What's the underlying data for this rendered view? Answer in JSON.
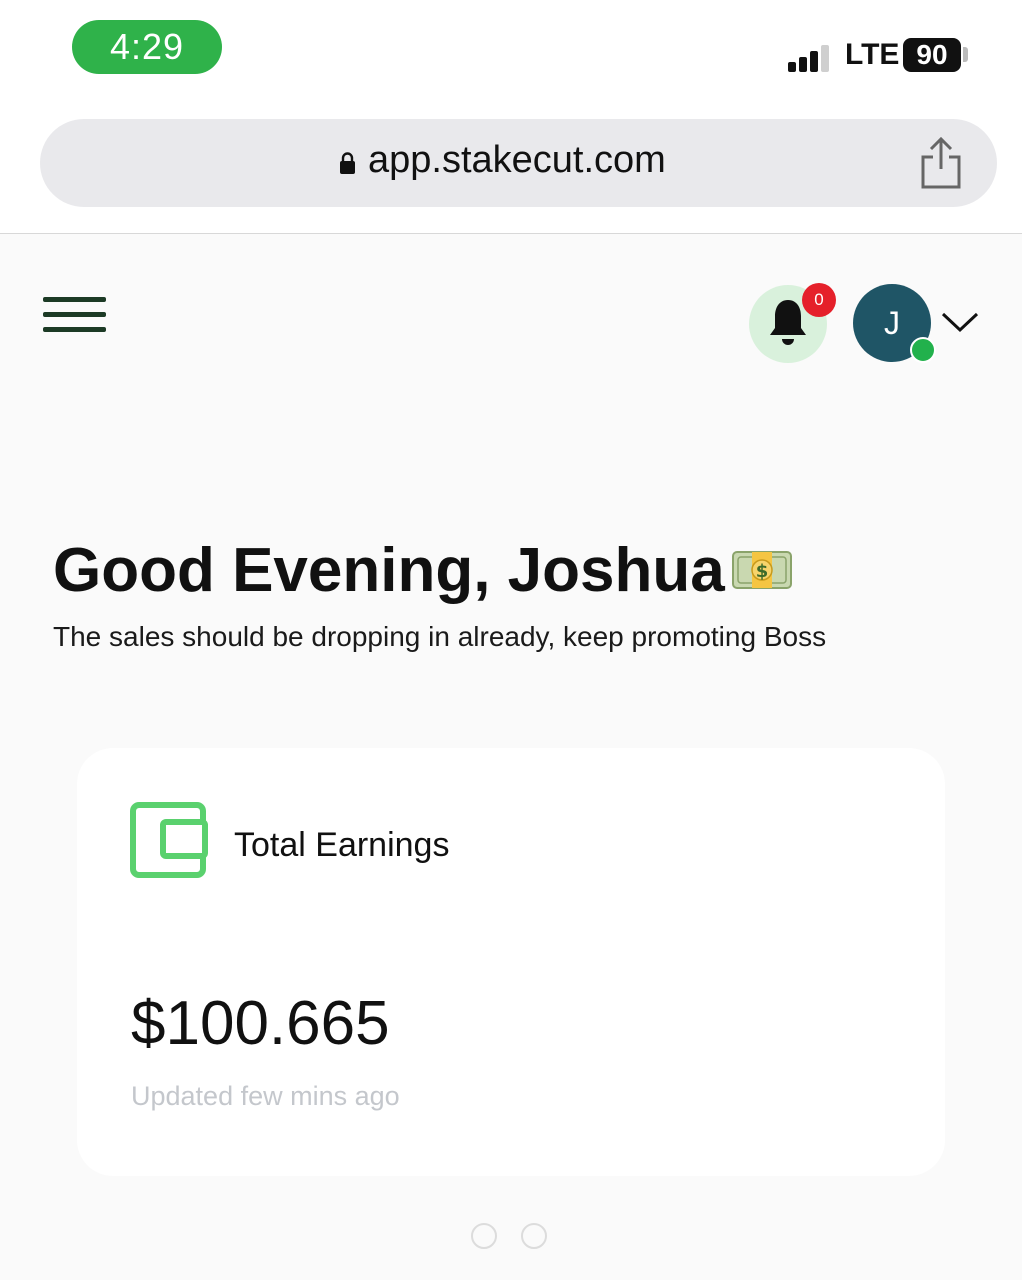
{
  "status_bar": {
    "time": "4:29",
    "network": "LTE",
    "battery": "90",
    "time_pill_color": "#2fb24a"
  },
  "browser": {
    "url": "app.stakecut.com",
    "lock_icon": "lock-icon",
    "share_icon": "share-icon"
  },
  "header": {
    "menu_icon": "hamburger-menu-icon",
    "notification_count": "0",
    "avatar_initial": "J",
    "status": "online",
    "accent_color": "#22b14c"
  },
  "greeting": {
    "title": "Good Evening, Joshua",
    "emoji": "money-bill-icon",
    "subtitle": "The sales should be dropping in already, keep promoting Boss"
  },
  "earnings_card": {
    "icon": "wallet-icon",
    "title": "Total Earnings",
    "amount": "$100.665",
    "updated": "Updated few mins ago"
  },
  "pagination": {
    "pages": 2
  }
}
